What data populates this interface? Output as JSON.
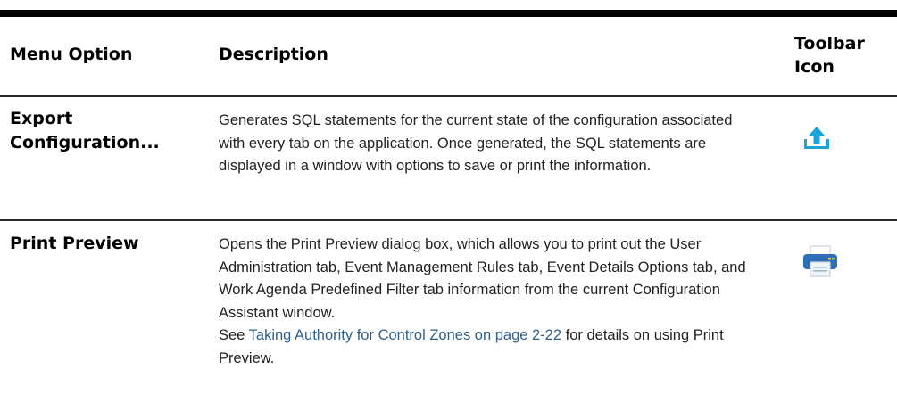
{
  "header": {
    "menu_option": "Menu Option",
    "description": "Description",
    "toolbar_icon": "Toolbar Icon"
  },
  "rows": [
    {
      "menu_option": "Export Configuration...",
      "description_lines": [
        "Generates SQL statements for the current state of the configuration associated with every tab on the application. Once generated, the SQL statements are displayed in a window with options to save or print the information."
      ],
      "icon": "export-upload-icon",
      "icon_color": "#1aa3d9"
    },
    {
      "menu_option": "Print Preview",
      "description_main": "Opens the Print Preview dialog box, which allows you to print out the User Administration tab, Event Management Rules tab, Event Details Options tab, and Work Agenda Predefined Filter tab information from the current Configuration Assistant window.",
      "description_see_prefix": "See",
      "description_link": "Taking Authority for Control Zones on page 2-22",
      "description_see_suffix": "for details on using Print Preview.",
      "icon": "printer-icon",
      "icon_color": "#2f6fb8"
    }
  ]
}
